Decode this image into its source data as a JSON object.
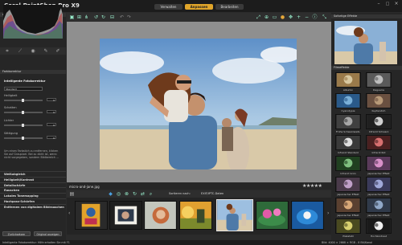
{
  "window": {
    "title": "Corel PaintShop Pro X9",
    "menu": [
      "Datei",
      "Bearbeiten",
      "Ansicht",
      "Hilfe"
    ],
    "controls": [
      "–",
      "□",
      "×"
    ]
  },
  "modes": [
    "Verwalten",
    "Anpassen",
    "Bearbeiten"
  ],
  "left_panel": {
    "histogram_header": "Anpassen",
    "tool_header": "Farbkorrektur",
    "tool_title": "Intelligente Fotokorrektur",
    "preset_value": "Standard",
    "sliders": [
      {
        "label": "Helligkeit",
        "level": 0.5
      },
      {
        "label": "Schatten",
        "level": 0.5
      },
      {
        "label": "Lichter",
        "level": 0.5
      },
      {
        "label": "Sättigung",
        "level": 0.5
      }
    ],
    "hint": "Um einen Farbstich zu entfernen, klicken Sie auf Graupixel. Bei zu dicht ist, wenn nicht vorgegeben, sondern Bildbereich ...",
    "sections": [
      "Weißabgleich",
      "Helligkeit/Kontrast",
      "Detailschärfe",
      "Rauschen",
      "Lokales Tonemapping",
      "Hochpass-Schärfen",
      "Entfernen von digitalem Bildrauschen"
    ],
    "buttons": [
      "Zurücksetzen",
      "Original anzeigen"
    ]
  },
  "center": {
    "filename": "micro-and-jane.jpg",
    "rating": "★★★★★",
    "sort_label": "Sortieren nach:",
    "view_label": "EXIF/IPTC-Daten",
    "thumb_count": 7,
    "selected_thumb": 4
  },
  "right_panel": {
    "header": "Sofortige Effekte",
    "category": "Filmeffekte",
    "effects": [
      "Albumin",
      "Daguerre",
      "Cyanotypie",
      "Kupferstich",
      "Frühe Schwarzweiß-",
      "Infrarot Schwarz",
      "Infrarot Standard",
      "Infrarot Rot",
      "Infrarot Grün",
      "Japanischer Effekt",
      "Japanischer Effekt",
      "Japanischer Effekt",
      "Japanischer Effekt",
      "Japanischer Effekt",
      "Plakatstil",
      "Hochkontrast"
    ]
  },
  "status": {
    "left": "Intelligente Fotokorrektur: Hilfe erhalten Sie mit F1",
    "right": "Bild: 4000 × 2668 × RGB - 8 Bit/Kanal"
  },
  "colors": {
    "accent": "#e0a52a",
    "panel": "#262626",
    "canvas": "#8f8f8f"
  }
}
